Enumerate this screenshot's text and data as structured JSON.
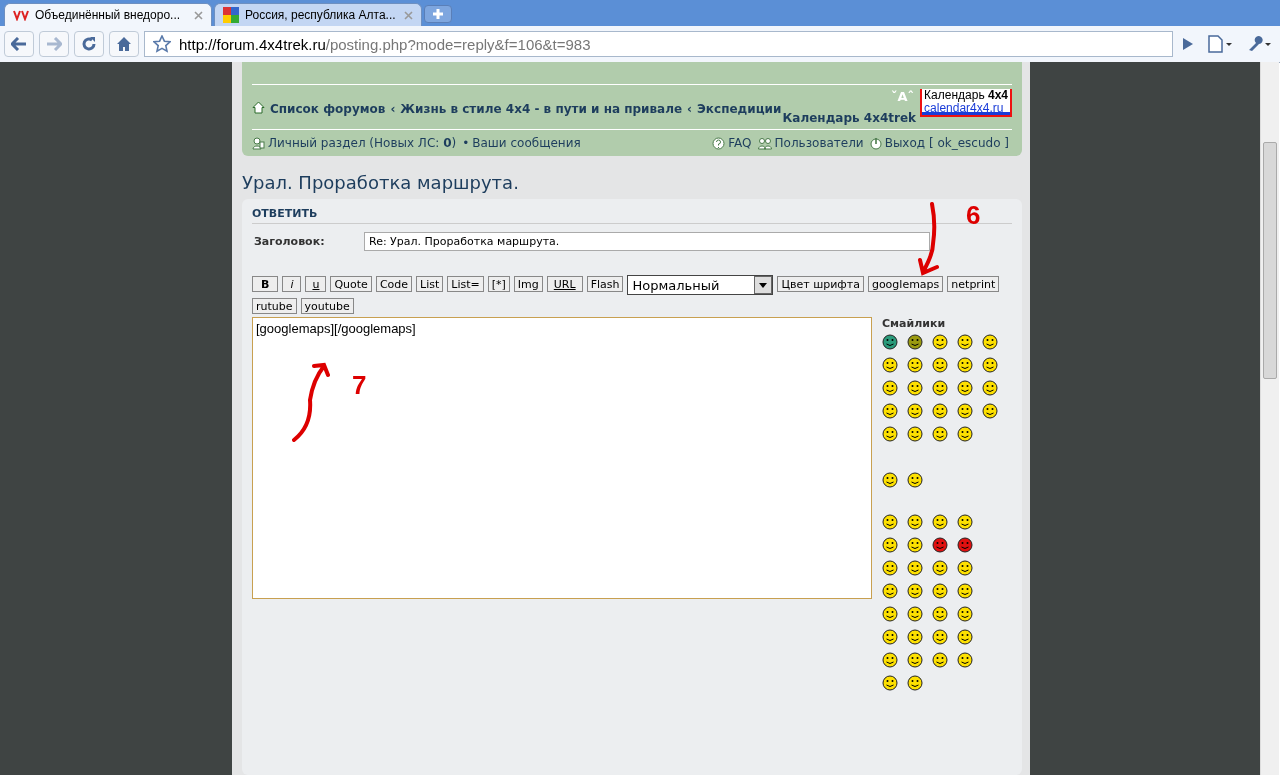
{
  "browser": {
    "tabs": [
      {
        "title": "Объединённый внедоро...",
        "selected": true
      },
      {
        "title": "Россия, республика Алта...",
        "selected": false
      }
    ],
    "url_host": "http://forum.4x4trek.ru",
    "url_path": "/posting.php?mode=reply&f=106&t=983"
  },
  "header": {
    "breadcrumbs": [
      "Список форумов",
      "Жизнь в стиле 4x4 - в пути и на привале",
      "Экспедиции"
    ],
    "separator": "‹",
    "font_size_control": "ˇAˆ",
    "calendar_banner": {
      "title": "Календарь ",
      "title_bold": "4x4",
      "subtitle": "calendar4x4.ru"
    },
    "calendar_link": "Календарь 4x4trek",
    "user_links": [
      {
        "kind": "pm",
        "text": "Личный раздел (Новых ЛС: **0**)"
      },
      {
        "kind": "bullet",
        "text": "•"
      },
      {
        "kind": "plain",
        "text": "Ваши сообщения"
      }
    ],
    "right_links": [
      {
        "kind": "faq",
        "text": "FAQ"
      },
      {
        "kind": "users",
        "text": "Пользователи"
      },
      {
        "kind": "logout",
        "text": "Выход [ ok_escudo ]"
      }
    ]
  },
  "topic_title": "Урал. Проработка маршрута.",
  "post": {
    "heading": "ОТВЕТИТЬ",
    "subject_label": "Заголовок:",
    "subject_value": "Re: Урал. Проработка маршрута.",
    "buttons": [
      {
        "label": "B",
        "kind": "bold"
      },
      {
        "label": "i",
        "kind": "italic"
      },
      {
        "label": "u",
        "kind": "underline"
      },
      {
        "label": "Quote",
        "kind": "plain"
      },
      {
        "label": "Code",
        "kind": "plain"
      },
      {
        "label": "List",
        "kind": "plain"
      },
      {
        "label": "List=",
        "kind": "plain"
      },
      {
        "label": "[*]",
        "kind": "plain"
      },
      {
        "label": "Img",
        "kind": "plain"
      },
      {
        "label": "URL",
        "kind": "underline"
      },
      {
        "label": "Flash",
        "kind": "plain"
      },
      {
        "label": "Нормальный",
        "kind": "dropdown"
      },
      {
        "label": "Цвет шрифта",
        "kind": "plain"
      },
      {
        "label": "googlemaps",
        "kind": "plain"
      },
      {
        "label": "netprint",
        "kind": "plain"
      },
      {
        "label": "rutube",
        "kind": "plain"
      },
      {
        "label": "youtube",
        "kind": "plain"
      }
    ],
    "message": "[googlemaps][/googlemaps]",
    "smilies_title": "Смайлики"
  },
  "annotations": [
    {
      "label": "6"
    },
    {
      "label": "7"
    }
  ]
}
